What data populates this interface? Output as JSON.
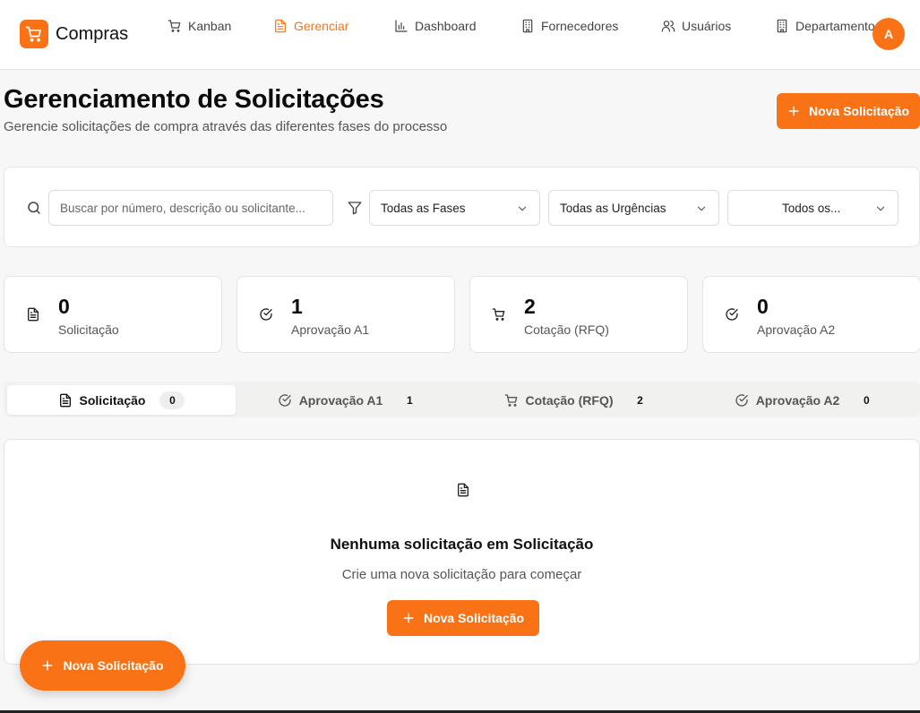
{
  "app": {
    "name": "Compras",
    "logo_icon": "shopping-cart-icon",
    "accent": "#f97316"
  },
  "nav": [
    {
      "label": "Kanban",
      "icon": "shopping-cart-icon",
      "active": false
    },
    {
      "label": "Gerenciar",
      "icon": "file-text-icon",
      "active": true
    },
    {
      "label": "Dashboard",
      "icon": "bar-chart-icon",
      "active": false
    },
    {
      "label": "Fornecedores",
      "icon": "building-icon",
      "active": false
    },
    {
      "label": "Usuários",
      "icon": "users-icon",
      "active": false
    },
    {
      "label": "Departamentos",
      "icon": "building-icon",
      "active": false
    }
  ],
  "user": {
    "initial": "A"
  },
  "header": {
    "title": "Gerenciamento de Solicitações",
    "subtitle": "Gerencie solicitações de compra através das diferentes fases do processo",
    "new_button": "Nova Solicitação"
  },
  "filters": {
    "search_placeholder": "Buscar por número, descrição ou solicitante...",
    "phase": "Todas as Fases",
    "urgency": "Todas as Urgências",
    "department": "Todos os..."
  },
  "stats": [
    {
      "value": "0",
      "label": "Solicitação",
      "icon": "file-text-icon"
    },
    {
      "value": "1",
      "label": "Aprovação A1",
      "icon": "check-circle-icon"
    },
    {
      "value": "2",
      "label": "Cotação (RFQ)",
      "icon": "shopping-cart-icon"
    },
    {
      "value": "0",
      "label": "Aprovação A2",
      "icon": "check-circle-icon"
    }
  ],
  "tabs": [
    {
      "label": "Solicitação",
      "count": "0",
      "icon": "file-text-icon",
      "active": true
    },
    {
      "label": "Aprovação A1",
      "count": "1",
      "icon": "check-circle-icon",
      "active": false
    },
    {
      "label": "Cotação (RFQ)",
      "count": "2",
      "icon": "shopping-cart-icon",
      "active": false
    },
    {
      "label": "Aprovação A2",
      "count": "0",
      "icon": "check-circle-icon",
      "active": false
    }
  ],
  "empty_state": {
    "title": "Nenhuma solicitação em Solicitação",
    "subtitle": "Crie uma nova solicitação para começar",
    "button": "Nova Solicitação"
  },
  "fab": {
    "label": "Nova Solicitação"
  }
}
